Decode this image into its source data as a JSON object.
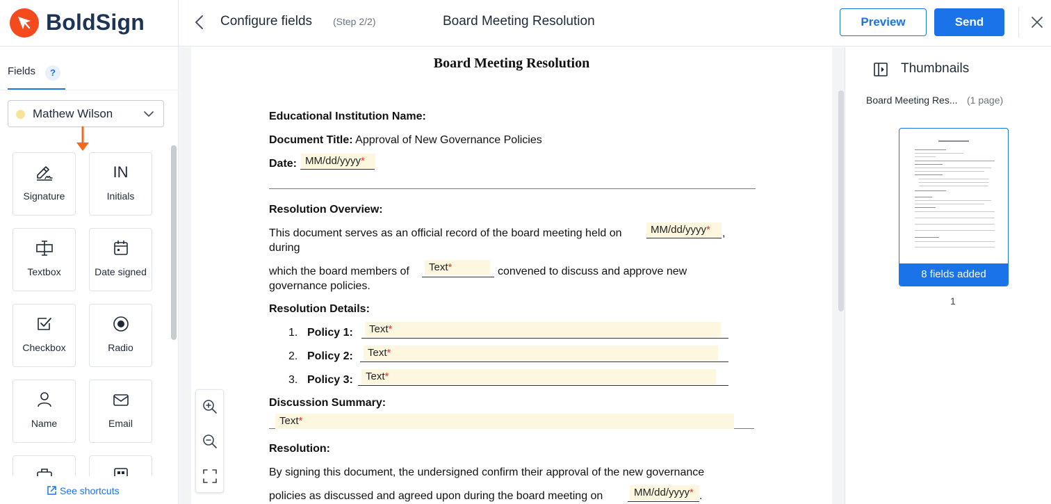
{
  "brand": {
    "name": "BoldSign",
    "color": "#f44b1e"
  },
  "header": {
    "title": "Configure fields",
    "step": "(Step 2/2)",
    "document_name": "Board Meeting Resolution",
    "preview_label": "Preview",
    "send_label": "Send",
    "accent": "#1a73e8"
  },
  "sidebar": {
    "tab_label": "Fields",
    "help": "?",
    "signer": "Mathew Wilson",
    "signer_color": "#f8e39a",
    "fields": [
      {
        "label": "Signature",
        "icon": "signature-icon"
      },
      {
        "label": "Initials",
        "icon": "initials-icon",
        "glyph": "IN"
      },
      {
        "label": "Textbox",
        "icon": "textbox-icon"
      },
      {
        "label": "Date signed",
        "icon": "calendar-icon"
      },
      {
        "label": "Checkbox",
        "icon": "checkbox-icon"
      },
      {
        "label": "Radio",
        "icon": "radio-icon"
      },
      {
        "label": "Name",
        "icon": "person-icon"
      },
      {
        "label": "Email",
        "icon": "email-icon"
      }
    ],
    "shortcuts": "See shortcuts"
  },
  "document": {
    "title": "Board Meeting Resolution",
    "institution_label": "Educational Institution Name:",
    "doc_title_label": "Document Title:",
    "doc_title_value": "Approval of New Governance Policies",
    "date_label": "Date:",
    "date_placeholder": "MM/dd/yyyy",
    "overview_heading": "Resolution Overview:",
    "overview_line1": "This document serves as an official record of the board meeting held on",
    "overview_comma": ",",
    "overview_line2": "during",
    "overview_line3a": "which the board members of",
    "overview_line3b": "convened to discuss and approve new",
    "overview_line4": "governance policies.",
    "text_placeholder": "Text",
    "required_mark": "*",
    "details_heading": "Resolution Details:",
    "policies": [
      {
        "num": "1.",
        "label": "Policy 1:"
      },
      {
        "num": "2.",
        "label": "Policy 2:"
      },
      {
        "num": "3.",
        "label": "Policy 3:"
      }
    ],
    "discussion_heading": "Discussion Summary:",
    "resolution_heading": "Resolution:",
    "resolution_line1": "By signing this document, the undersigned confirm their approval of the new governance",
    "resolution_line2": "policies as discussed and agreed upon during the board meeting on",
    "resolution_period": "."
  },
  "thumbnails": {
    "title": "Thumbnails",
    "doc_name": "Board Meeting Res...",
    "page_count": "(1 page)",
    "badge": "8 fields added",
    "page_number": "1"
  }
}
